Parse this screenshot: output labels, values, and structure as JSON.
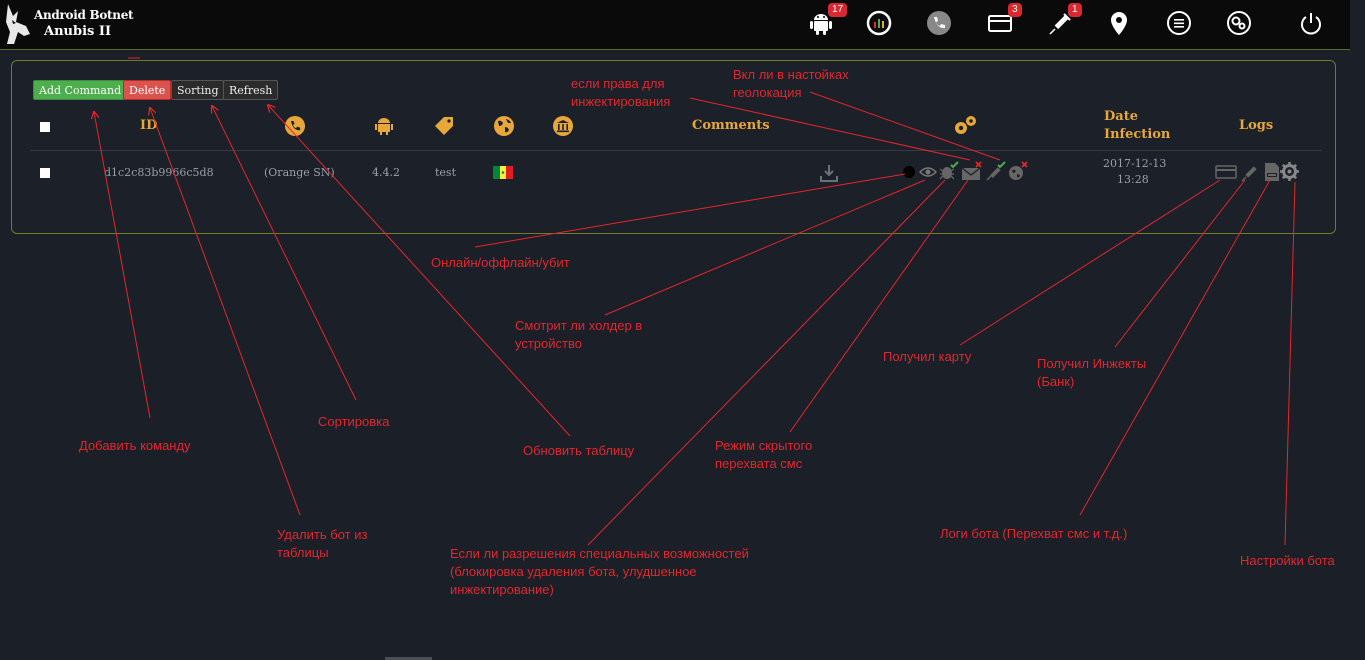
{
  "brand": {
    "line1": "Android Botnet",
    "line2": "Anubis II"
  },
  "nav": {
    "items": [
      {
        "name": "android-icon",
        "badge": "17"
      },
      {
        "name": "stats-icon",
        "badge": ""
      },
      {
        "name": "phone-icon",
        "badge": ""
      },
      {
        "name": "card-icon",
        "badge": "3"
      },
      {
        "name": "syringe-icon",
        "badge": "1"
      },
      {
        "name": "location-pin-icon",
        "badge": ""
      },
      {
        "name": "list-icon",
        "badge": ""
      },
      {
        "name": "settings-icon",
        "badge": ""
      },
      {
        "name": "power-icon",
        "badge": ""
      }
    ]
  },
  "toolbar": {
    "add": "Add Command",
    "delete": "Delete",
    "sorting": "Sorting",
    "refresh": "Refresh"
  },
  "table": {
    "headers": {
      "id": "ID",
      "comments": "Comments",
      "date_line1": "Date",
      "date_line2": "Infection",
      "logs": "Logs"
    },
    "row": {
      "id": "d1c2c83b9966c5d8",
      "operator": "(Orange SN)",
      "android": "4.4.2",
      "tag": "test",
      "country_flag": "senegal",
      "date": "2017-12-13",
      "time": "13:28"
    }
  },
  "annotations": {
    "inject_rights": "если права для\nинжектирования",
    "geolocation": "Вкл ли в настойках\nгеолокация",
    "online": "Онлайн/оффлайн/убит",
    "holder_looking": "Смотрит ли холдер в\nустройство",
    "got_card": "Получил карту",
    "got_injects": "Получил Инжекты\n(Банк)",
    "add_command": "Добавить команду",
    "sorting": "Сортировка",
    "refresh_table": "Обновить таблицу",
    "hidden_sms": "Режим скрытого\nперехвата смс",
    "delete_bot": "Удалить бот из\nтаблицы",
    "accessibility": "Если ли разрешения специальных возможностей\n(блокировка удаления бота, улудшенное\nинжектирование)",
    "bot_logs": "Логи бота (Перехват смс и т.д.)",
    "bot_settings": "Настройки бота"
  },
  "colors": {
    "accent": "#e8a73a",
    "annotation": "#e4262c",
    "panel_border": "#6f7a2a",
    "badge": "#d9282f"
  }
}
